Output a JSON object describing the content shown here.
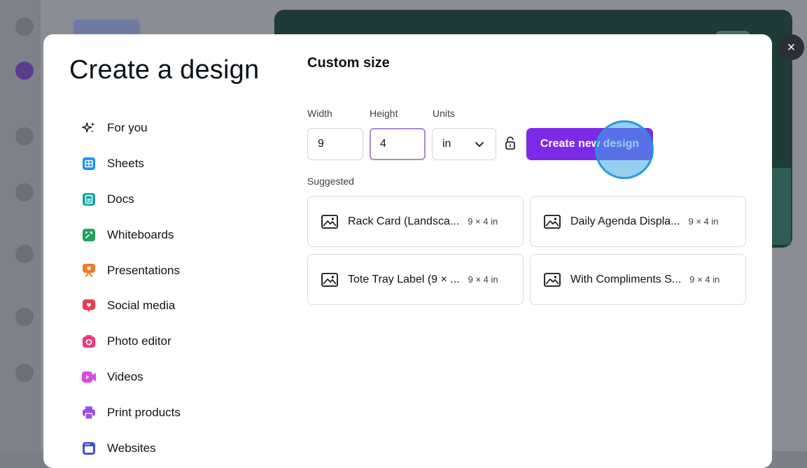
{
  "modal": {
    "title": "Create a design",
    "close_label": "×"
  },
  "menu": [
    {
      "label": "For you",
      "icon": "sparkle-icon"
    },
    {
      "label": "Sheets",
      "icon": "sheets-icon"
    },
    {
      "label": "Docs",
      "icon": "docs-icon"
    },
    {
      "label": "Whiteboards",
      "icon": "whiteboards-icon"
    },
    {
      "label": "Presentations",
      "icon": "presentations-icon"
    },
    {
      "label": "Social media",
      "icon": "social-media-icon"
    },
    {
      "label": "Photo editor",
      "icon": "photo-editor-icon"
    },
    {
      "label": "Videos",
      "icon": "videos-icon"
    },
    {
      "label": "Print products",
      "icon": "print-products-icon"
    },
    {
      "label": "Websites",
      "icon": "websites-icon"
    }
  ],
  "custom": {
    "title": "Custom size",
    "width_label": "Width",
    "height_label": "Height",
    "units_label": "Units",
    "width_value": "9",
    "height_value": "4",
    "units_value": "in",
    "create_label": "Create new design",
    "suggested_label": "Suggested"
  },
  "suggestions": [
    {
      "name": "Rack Card (Landsca...",
      "size": "9 × 4 in"
    },
    {
      "name": "Daily Agenda Displa...",
      "size": "9 × 4 in"
    },
    {
      "name": "Tote Tray Label (9 × ...",
      "size": "9 × 4 in"
    },
    {
      "name": "With Compliments S...",
      "size": "9 × 4 in"
    }
  ],
  "colors": {
    "accent": "#7d2ae8",
    "close_bg": "#2b2f36",
    "sheets": "#1f8ef1",
    "docs": "#15a4a8",
    "whiteboards": "#1fa35f",
    "presentations": "#f07a2a",
    "social": "#ef3b4d",
    "photo": "#f0357d",
    "videos": "#d94ae8",
    "print": "#9b4fe8",
    "websites": "#3f4fd8"
  }
}
